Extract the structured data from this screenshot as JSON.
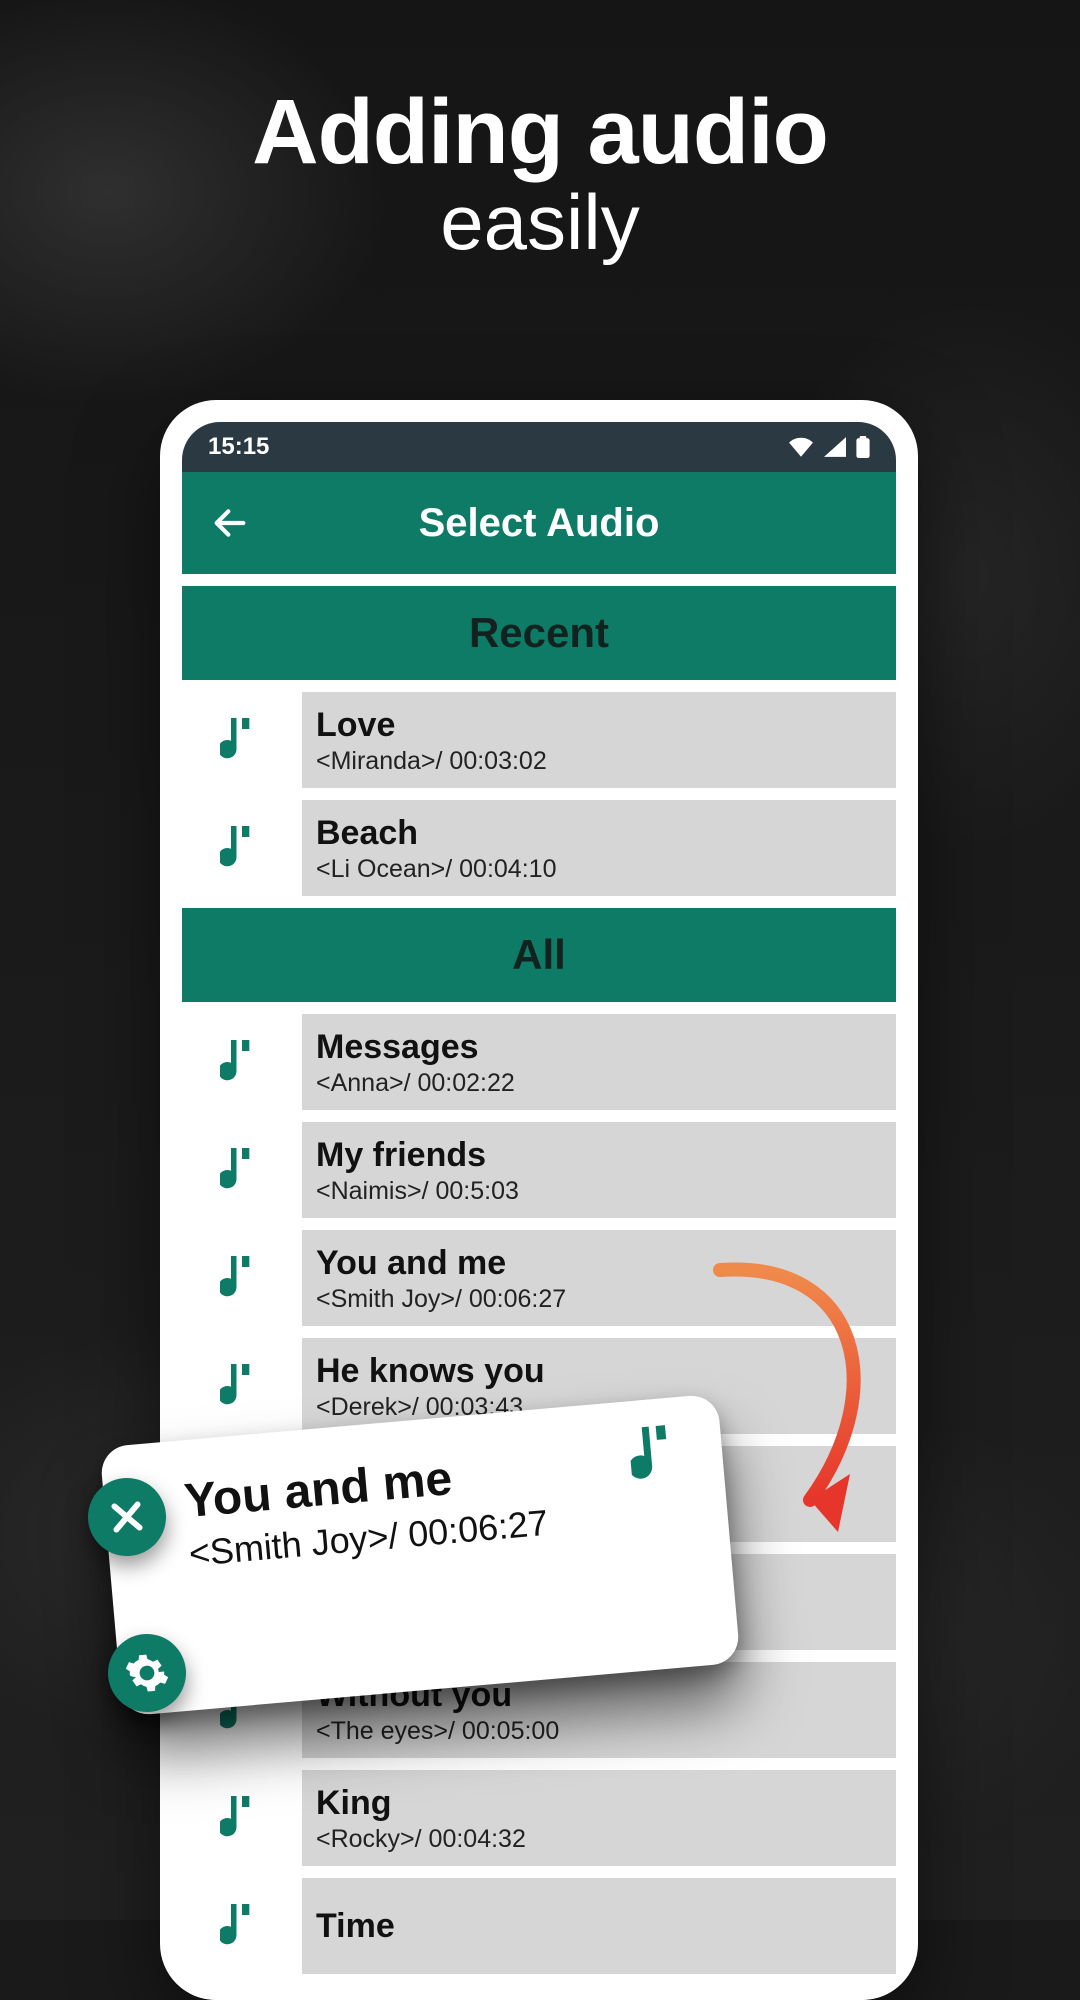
{
  "hero": {
    "line1": "Adding audio",
    "line2": "easily"
  },
  "status": {
    "time": "15:15"
  },
  "appbar": {
    "title": "Select Audio"
  },
  "sections": {
    "recent_label": "Recent",
    "all_label": "All"
  },
  "recent": [
    {
      "title": "Love",
      "sub": "<Miranda>/ 00:03:02"
    },
    {
      "title": "Beach",
      "sub": "<Li Ocean>/ 00:04:10"
    }
  ],
  "all": [
    {
      "title": "Messages",
      "sub": "<Anna>/ 00:02:22"
    },
    {
      "title": "My friends",
      "sub": "<Naimis>/ 00:5:03"
    },
    {
      "title": "You and me",
      "sub": "<Smith Joy>/ 00:06:27"
    },
    {
      "title": "He knows you",
      "sub": "<Derek>/ 00:03:43"
    },
    {
      "title": "",
      "sub": ""
    },
    {
      "title": "",
      "sub": ""
    },
    {
      "title": "Without you",
      "sub": "<The eyes>/ 00:05:00"
    },
    {
      "title": "King",
      "sub": "<Rocky>/ 00:04:32"
    },
    {
      "title": "Time",
      "sub": ""
    }
  ],
  "float_card": {
    "title": "You and me",
    "sub": "<Smith Joy>/ 00:06:27"
  },
  "colors": {
    "teal": "#0e7b66",
    "row_bg": "#d6d6d6"
  }
}
